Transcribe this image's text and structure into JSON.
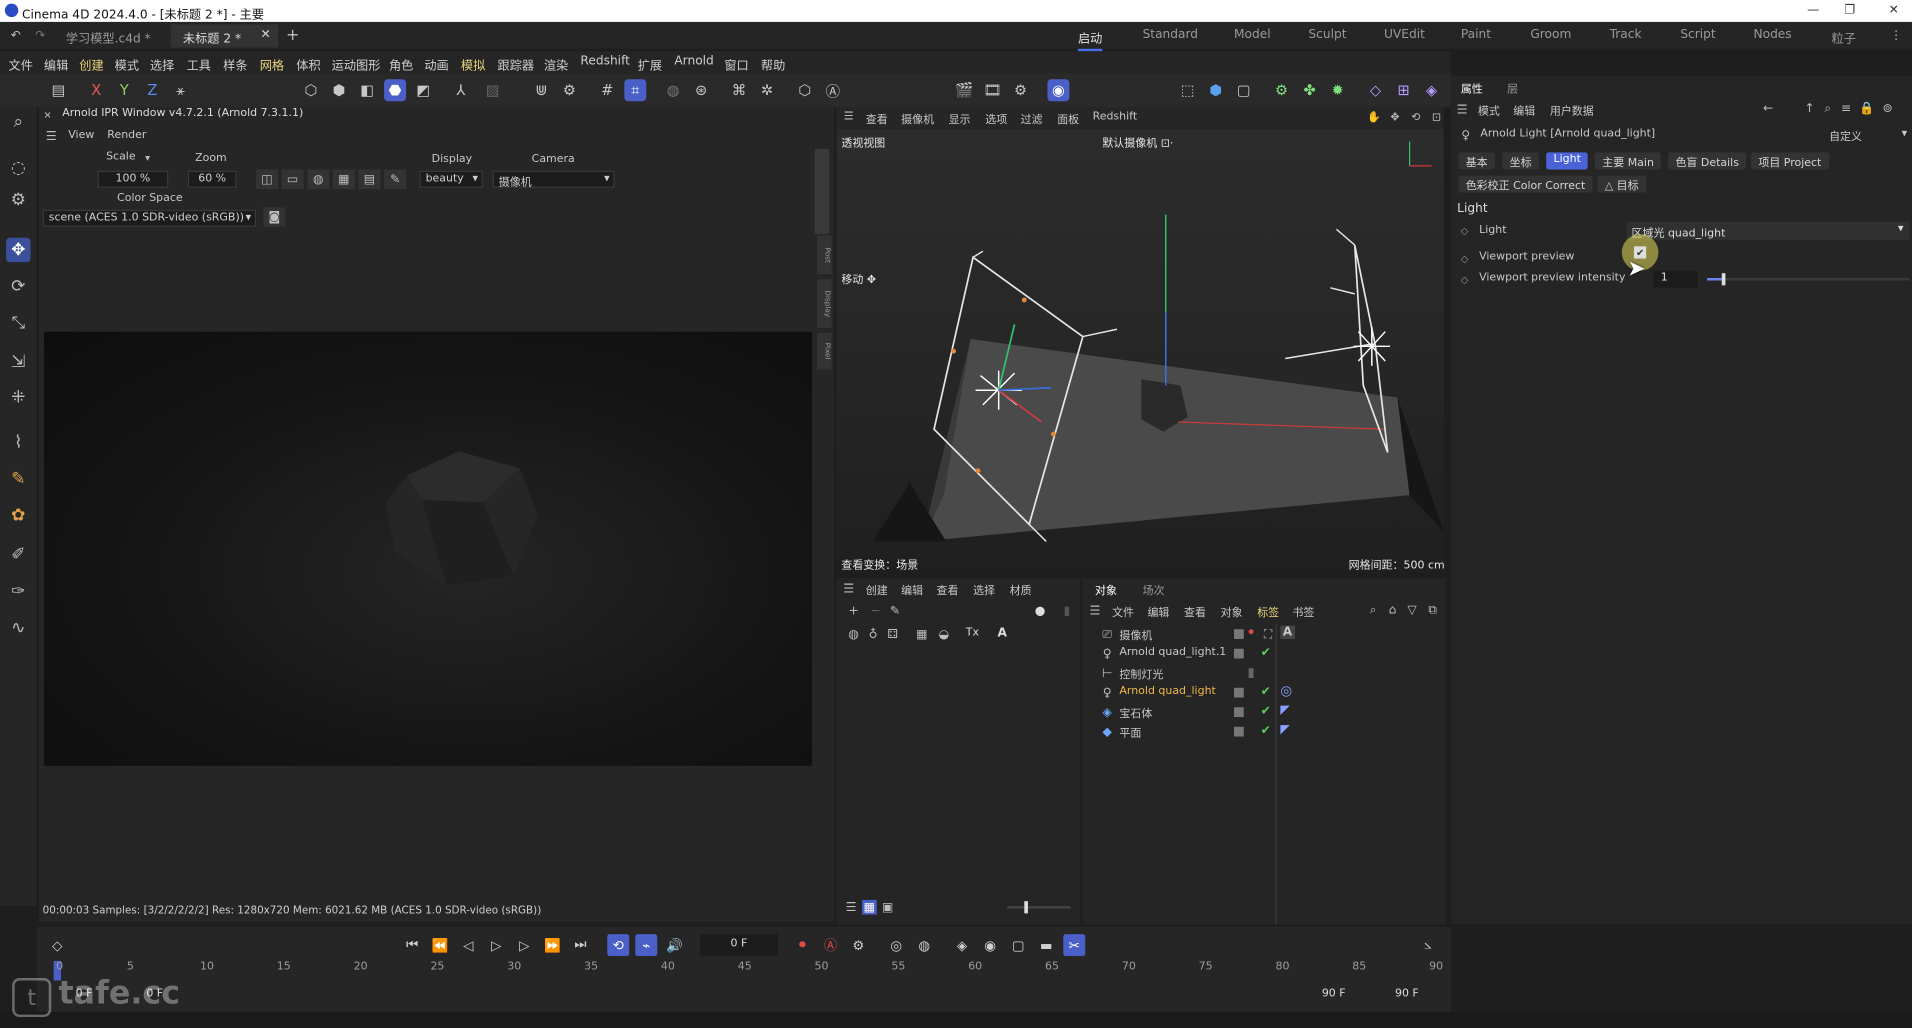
{
  "window": {
    "title": "Cinema 4D 2024.4.0 - [未标题 2 *] - 主要"
  },
  "doc_tabs": [
    {
      "label": "学习模型.c4d *"
    },
    {
      "label": "未标题 2 *"
    }
  ],
  "layouts": [
    {
      "label": "启动",
      "active": true
    },
    {
      "label": "Standard"
    },
    {
      "label": "Model"
    },
    {
      "label": "Sculpt"
    },
    {
      "label": "UVEdit"
    },
    {
      "label": "Paint"
    },
    {
      "label": "Groom"
    },
    {
      "label": "Track"
    },
    {
      "label": "Script"
    },
    {
      "label": "Nodes"
    },
    {
      "label": "粒子"
    }
  ],
  "menu": [
    "文件",
    "编辑",
    "创建",
    "模式",
    "选择",
    "工具",
    "样条",
    "网格",
    "体积",
    "运动图形",
    "角色",
    "动画",
    "模拟",
    "跟踪器",
    "渲染",
    "Redshift",
    "扩展",
    "Arnold",
    "窗口",
    "帮助"
  ],
  "axis_labels": {
    "x": "X",
    "y": "Y",
    "z": "Z"
  },
  "ipr": {
    "title": "Arnold IPR Window v4.7.2.1 (Arnold 7.3.1.1)",
    "menu_view": "View",
    "menu_render": "Render",
    "scale_label": "Scale",
    "scale_value": "100 %",
    "zoom_label": "Zoom",
    "zoom_value": "60 %",
    "display_label": "Display",
    "display_value": "beauty",
    "camera_label": "Camera",
    "camera_value": "摄像机",
    "colorspace_label": "Color Space",
    "colorspace_value": "scene (ACES 1.0 SDR-video (sRGB))",
    "side_tabs": [
      "Post",
      "Display",
      "Pixel"
    ],
    "status": "00:00:03  Samples: [3/2/2/2/2/2]  Res: 1280x720  Mem: 6021.62 MB  (ACES 1.0 SDR-video (sRGB))"
  },
  "viewport": {
    "menu": [
      "查看",
      "摄像机",
      "显示",
      "选项",
      "过滤",
      "面板",
      "Redshift"
    ],
    "view_name": "透视视图",
    "camera_name": "默认摄像机 ⊡·",
    "move_label": "移动 ✥",
    "view_transform": "查看变换：场景",
    "grid_spacing": "网格间距：500 cm"
  },
  "material_panel": {
    "menu": [
      "创建",
      "编辑",
      "查看",
      "选择",
      "材质"
    ],
    "tx": "Tx",
    "a": "A"
  },
  "object_panel": {
    "tabs": [
      "对象",
      "场次"
    ],
    "menu": [
      "文件",
      "编辑",
      "查看",
      "对象",
      "标签",
      "书签"
    ],
    "objects": [
      {
        "name": "摄像机",
        "icon": "camera-icon",
        "tag": "A"
      },
      {
        "name": "Arnold quad_light.1",
        "icon": "light-icon",
        "tag": ""
      },
      {
        "name": "控制灯光",
        "icon": "null-icon",
        "tag": ""
      },
      {
        "name": "Arnold quad_light",
        "icon": "light-icon",
        "tag": "◎",
        "selected": true
      },
      {
        "name": "宝石体",
        "icon": "gem-icon",
        "tag": "◤"
      },
      {
        "name": "平面",
        "icon": "plane-icon",
        "tag": "◤"
      }
    ]
  },
  "attributes": {
    "tabs": [
      "属性",
      "层"
    ],
    "menu": [
      "模式",
      "编辑",
      "用户数据"
    ],
    "object_title": "Arnold Light [Arnold quad_light]",
    "preset": "自定义",
    "section_tabs": [
      {
        "label": "基本"
      },
      {
        "label": "坐标"
      },
      {
        "label": "Light",
        "active": true
      },
      {
        "label": "主要 Main"
      },
      {
        "label": "色盲 Details"
      },
      {
        "label": "项目 Project"
      },
      {
        "label": "色彩校正 Color Correct"
      },
      {
        "label": "△ 目标"
      }
    ],
    "section_title": "Light",
    "light_label": "Light",
    "light_value": "区域光 quad_light",
    "viewport_preview_label": "Viewport preview",
    "viewport_preview_checked": true,
    "intensity_label": "Viewport preview intensity",
    "intensity_value": "1",
    "intensity_fraction": 0.08
  },
  "timeline": {
    "frame": "0 F",
    "ticks": [
      "0",
      "5",
      "10",
      "15",
      "20",
      "25",
      "30",
      "35",
      "40",
      "45",
      "50",
      "55",
      "60",
      "65",
      "70",
      "75",
      "80",
      "85",
      "90"
    ],
    "start_a": "0 F",
    "start_b": "0 F",
    "end_a": "90 F",
    "end_b": "90 F"
  },
  "watermark": "tafe.cc"
}
